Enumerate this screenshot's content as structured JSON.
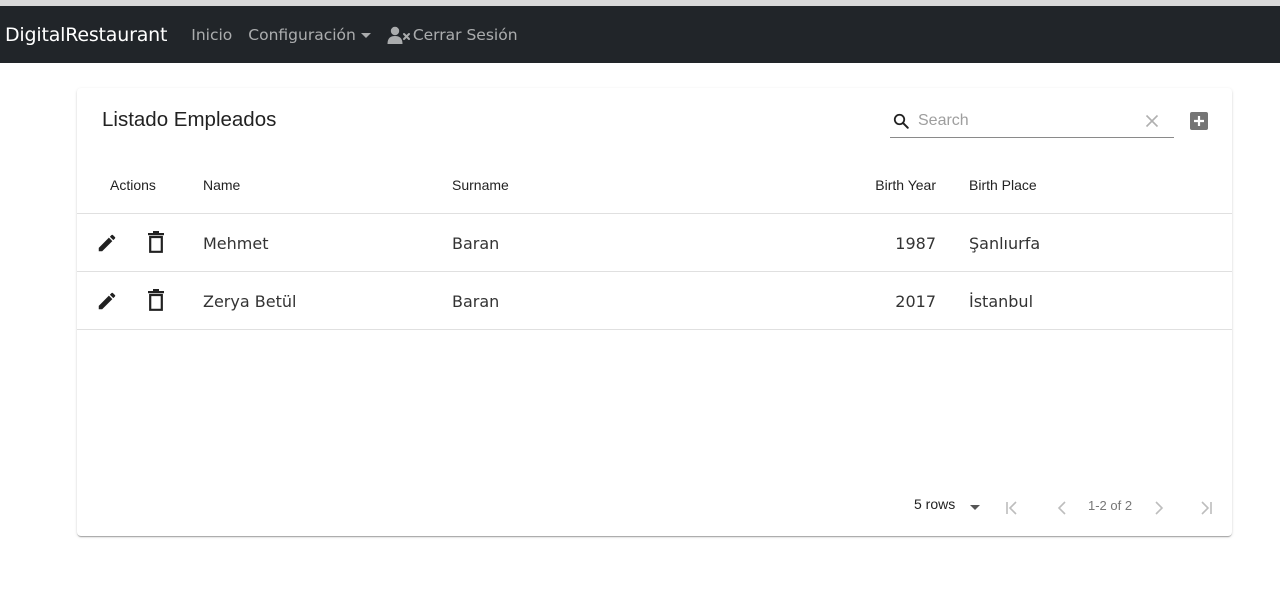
{
  "navbar": {
    "brand": "DigitalRestaurant",
    "links": [
      {
        "label": "Inicio"
      },
      {
        "label": "Configuración"
      },
      {
        "label": "Cerrar Sesión",
        "icon": "user-x-icon"
      }
    ]
  },
  "card": {
    "title": "Listado Empleados",
    "search": {
      "placeholder": "Search",
      "value": ""
    },
    "columns": [
      "Actions",
      "Name",
      "Surname",
      "Birth Year",
      "Birth Place"
    ],
    "rows": [
      {
        "name": "Mehmet",
        "surname": "Baran",
        "birth_year": "1987",
        "birth_place": "Şanlıurfa"
      },
      {
        "name": "Zerya Betül",
        "surname": "Baran",
        "birth_year": "2017",
        "birth_place": "İstanbul"
      }
    ],
    "pagination": {
      "rows_per_page": "5 rows",
      "range": "1-2 of 2"
    }
  },
  "colors": {
    "navbar_bg": "#212529",
    "icon_dark": "#212121",
    "icon_gray": "#9e9e9e"
  }
}
